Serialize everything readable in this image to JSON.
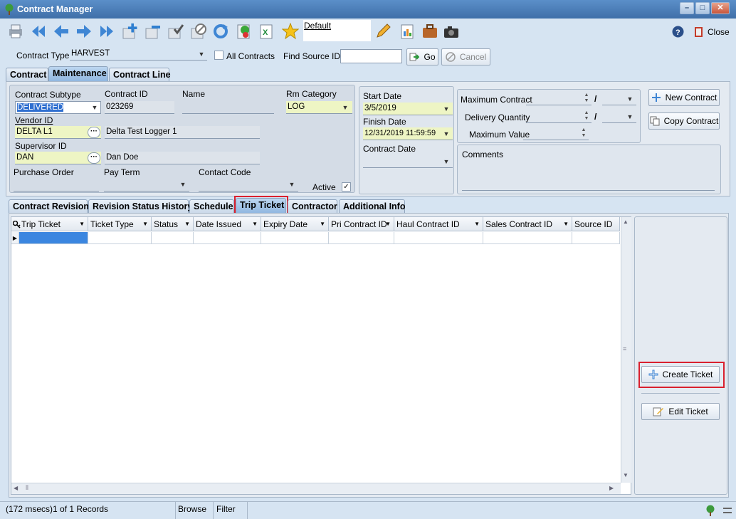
{
  "window": {
    "title": "Contract Manager"
  },
  "toolbar": {
    "default_label": "Default",
    "close_label": "Close",
    "buttons": [
      "print-icon",
      "first-record-icon",
      "previous-record-icon",
      "next-record-icon",
      "last-record-icon",
      "add-record-icon",
      "delete-record-icon",
      "save-record-icon",
      "cancel-edit-icon",
      "refresh-icon",
      "import-icon",
      "excel-export-icon",
      "favorite-star-icon",
      "edit-pencil-icon",
      "report-icon",
      "briefcase-icon",
      "camera-icon"
    ]
  },
  "filter": {
    "contract_type_label": "Contract Type",
    "contract_type_value": "HARVEST",
    "all_contracts_label": "All Contracts",
    "find_source_label": "Find Source ID:",
    "find_source_value": "",
    "go_label": "Go",
    "cancel_label": "Cancel"
  },
  "top_tabs": [
    "Contract",
    "Maintenance",
    "Contract Line"
  ],
  "form": {
    "contract_subtype_label": "Contract Subtype",
    "contract_subtype_value": "DELIVERED",
    "contract_id_label": "Contract ID",
    "contract_id_value": "023269",
    "name_label": "Name",
    "name_value": "",
    "rm_category_label": "Rm Category",
    "rm_category_value": "LOG",
    "vendor_id_label": "Vendor ID",
    "vendor_id_value": "DELTA L1",
    "vendor_name_value": "Delta Test Logger 1",
    "supervisor_id_label": "Supervisor ID",
    "supervisor_id_value": "DAN",
    "supervisor_name_value": "Dan Doe",
    "purchase_order_label": "Purchase Order",
    "pay_term_label": "Pay Term",
    "contact_code_label": "Contact Code",
    "active_label": "Active",
    "start_date_label": "Start Date",
    "start_date_value": "3/5/2019",
    "finish_date_label": "Finish Date",
    "finish_date_value": "12/31/2019 11:59:59",
    "contract_date_label": "Contract Date",
    "max_contract_label": "Maximum Contract",
    "delivery_qty_label": "Delivery Quantity",
    "max_value_label": "Maximum Value",
    "slash": "/",
    "comments_label": "Comments",
    "new_contract_label": "New Contract",
    "copy_contract_label": "Copy Contract"
  },
  "sub_tabs": [
    "Contract Revision",
    "Revision Status History",
    "Schedule",
    "Trip Ticket",
    "Contractor",
    "Additional Info"
  ],
  "grid": {
    "columns": [
      "Trip Ticket",
      "Ticket Type",
      "Status",
      "Date Issued",
      "Expiry Date",
      "Pri Contract ID",
      "Haul Contract ID",
      "Sales Contract ID",
      "Source ID"
    ]
  },
  "side_buttons": {
    "create_ticket": "Create Ticket",
    "edit_ticket": "Edit Ticket"
  },
  "status": {
    "records": "(172 msecs)1 of 1 Records",
    "mode": "Browse",
    "filter": "Filter"
  },
  "colors": {
    "highlight": "#d9202e",
    "accent": "#4a7fc0"
  }
}
